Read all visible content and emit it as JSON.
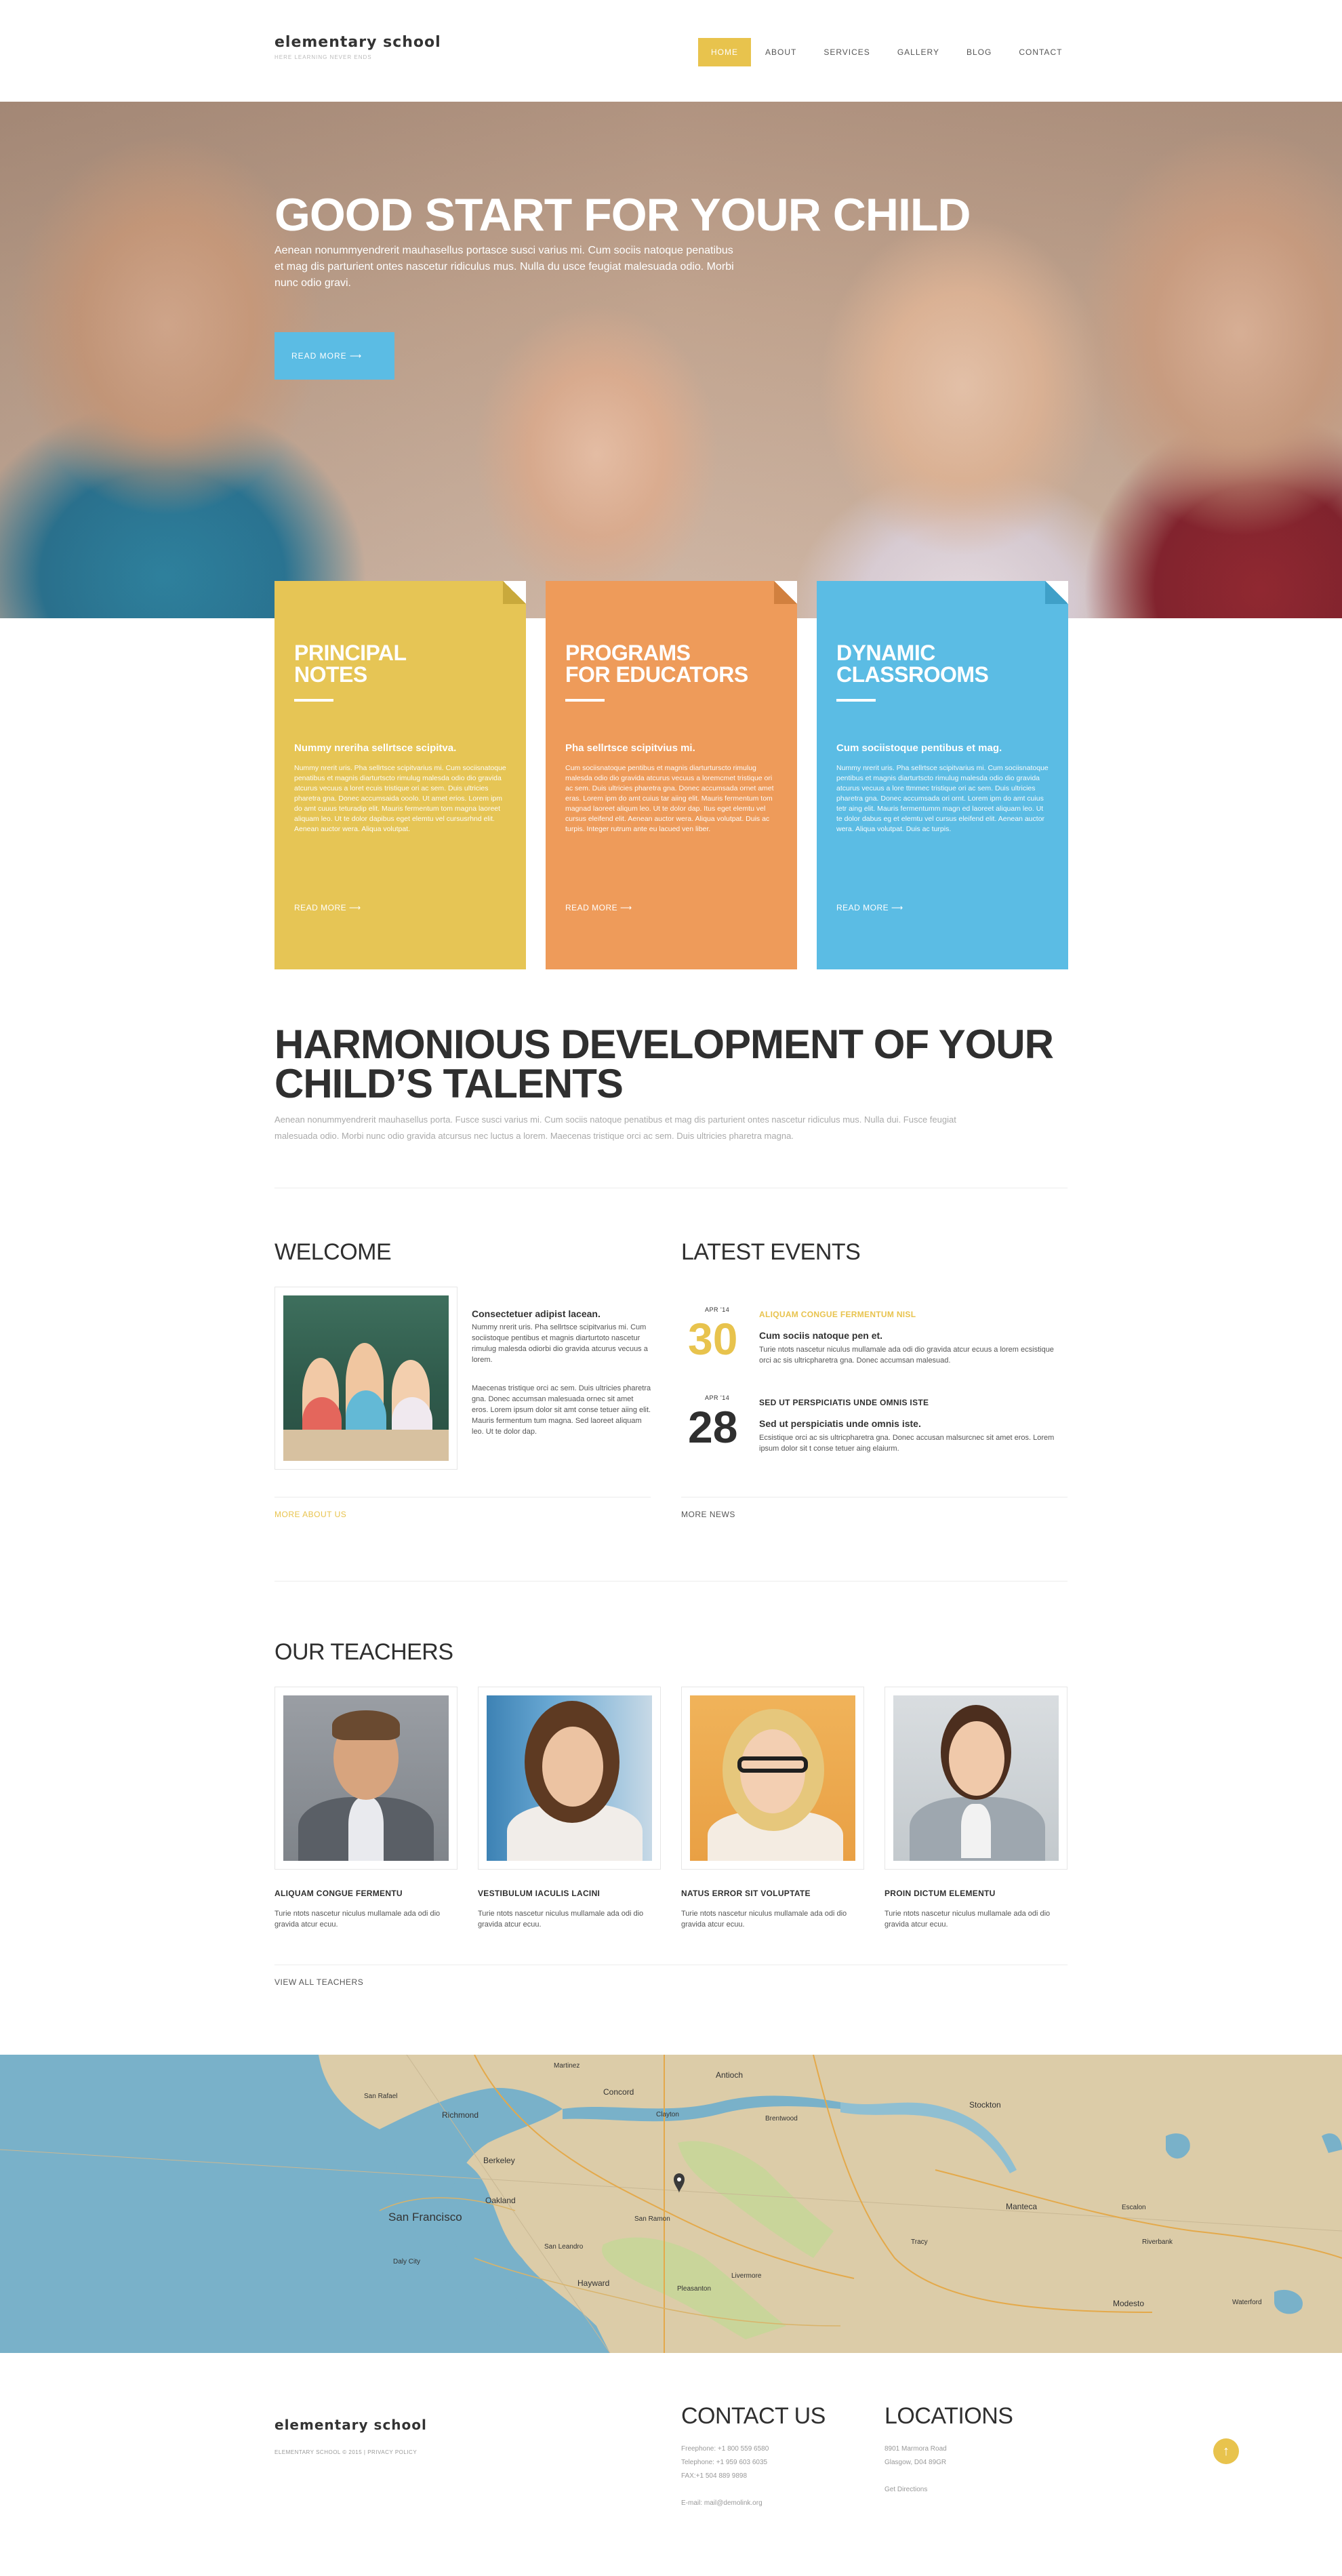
{
  "header": {
    "logo": "elementary school",
    "tagline": "HERE LEARNING NEVER ENDS",
    "nav": [
      "HOME",
      "ABOUT",
      "SERVICES",
      "GALLERY",
      "BLOG",
      "CONTACT"
    ]
  },
  "hero": {
    "title": "GOOD START FOR YOUR CHILD",
    "text": "Aenean nonummyendrerit mauhasellus portasce susci varius mi. Cum sociis natoque penatibus et mag dis parturient ontes nascetur ridiculus mus. Nulla du usce feugiat malesuada odio. Morbi nunc odio gravi.",
    "button": "READ MORE  ⟶"
  },
  "cards": [
    {
      "title_line1": "PRINCIPAL",
      "title_line2": "NOTES",
      "subtitle": "Nummy nreriha sellrtsce scipitva.",
      "body": "Nummy nrerit uris. Pha sellrtsce scipitvarius mi. Cum sociisnatoque penatibus et magnis diarturtscto rimulug malesda odio dio gravida atcurus vecuus a loret ecuis tristique ori ac sem. Duis ultricies pharetra gna. Donec accumsaida ooolo. Ut amet erios. Lorem ipm do amt cuuus teturadip elit. Mauris fermentum tom magna laoreet aliquam leo. Ut te dolor dapibus eget elemtu vel cursusrhnd elit. Aenean auctor wera. Aliqua volutpat.",
      "more": "READ MORE  ⟶"
    },
    {
      "title_line1": "PROGRAMS",
      "title_line2": "FOR EDUCATORS",
      "subtitle": "Pha sellrtsce scipitvius mi.",
      "body": "Cum sociisnatoque pentibus et magnis diarturturscto rimulug malesda odio dio gravida atcurus vecuus a loremcmet tristique ori ac sem. Duis ultricies pharetra gna. Donec accumsada ornet amet eras. Lorem ipm do amt cuius tar aiing elit. Mauris fermentum tom magnad laoreet aliqum leo. Ut te dolor dap. Itus eget elemtu vel cursus eleifend elit. Aenean auctor wera. Aliqua volutpat. Duis ac turpis. Integer rutrum ante eu lacued ven liber.",
      "more": "READ MORE  ⟶"
    },
    {
      "title_line1": "DYNAMIC",
      "title_line2": "CLASSROOMS",
      "subtitle": "Cum sociistoque pentibus et mag.",
      "body": "Nummy nrerit uris. Pha sellrtsce scipitvarius mi. Cum sociisnatoque pentibus et magnis diarturtscto rimulug malesda odio dio gravida atcurus vecuus a lore ttmmec tristique ori ac sem. Duis ultricies pharetra gna. Donec accumsada ori ornt. Lorem ipm do amt cuius tetr aing elit. Mauris fermentumm magn ed laoreet aliquam leo. Ut te dolor dabus eg et elemtu vel cursus eleifend elit. Aenean auctor wera. Aliqua volutpat. Duis ac turpis.",
      "more": "READ MORE  ⟶"
    }
  ],
  "harmonious": {
    "title": "HARMONIOUS DEVELOPMENT OF YOUR CHILD’S TALENTS",
    "text": "Aenean nonummyendrerit mauhasellus porta. Fusce susci varius mi. Cum sociis natoque penatibus et mag dis parturient ontes nascetur ridiculus mus. Nulla dui. Fusce feugiat malesuada odio. Morbi nunc odio gravida atcursus nec luctus a lorem. Maecenas tristique orci ac sem. Duis ultricies pharetra magna."
  },
  "welcome": {
    "heading": "WELCOME",
    "strong": "Consectetuer adipist lacean.",
    "body1": "Nummy nrerit uris. Pha sellrtsce scipitvarius mi. Cum sociistoque pentibus et magnis diarturtoto nascetur rimulug malesda odiorbi dio gravida atcurus vecuus a lorem.",
    "body2": "Maecenas tristique orci ac sem. Duis ultricies pharetra gna. Donec accumsan malesuada ornec sit amet eros. Lorem ipsum dolor sit amt conse tetuer aiing elit. Mauris fermentum tum magna. Sed laoreet aliquam leo. Ut te dolor dap.",
    "more": "MORE ABOUT US"
  },
  "events": {
    "heading": "LATEST EVENTS",
    "items": [
      {
        "month": "APR '14",
        "day": "30",
        "title": "ALIQUAM CONGUE FERMENTUM NISL",
        "subtitle": "Cum sociis natoque pen et.",
        "body": "Turie ntots nascetur niculus mullamale ada odi dio gravida atcur ecuus a lorem ecsistique orci ac sis ultricpharetra gna. Donec accumsan malesuad."
      },
      {
        "month": "APR '14",
        "day": "28",
        "title": "SED UT PERSPICIATIS UNDE OMNIS ISTE",
        "subtitle": "Sed ut perspiciatis unde omnis iste.",
        "body": "Ecsistique orci ac sis ultricpharetra gna. Donec accusan malsurcnec sit amet eros. Lorem ipsum dolor sit t conse tetuer aing elaiurm."
      }
    ],
    "more": "MORE NEWS"
  },
  "teachers": {
    "heading": "OUR TEACHERS",
    "items": [
      {
        "name": "ALIQUAM CONGUE FERMENTU",
        "text": "Turie ntots nascetur niculus mullamale ada odi dio gravida atcur ecuu."
      },
      {
        "name": "VESTIBULUM IACULIS LACINI",
        "text": "Turie ntots nascetur niculus mullamale ada odi dio gravida atcur ecuu."
      },
      {
        "name": "NATUS ERROR SIT VOLUPTATE",
        "text": "Turie ntots nascetur niculus mullamale ada odi dio gravida atcur ecuu."
      },
      {
        "name": "PROIN DICTUM ELEMENTU",
        "text": "Turie ntots nascetur niculus mullamale ada odi dio gravida atcur ecuu."
      }
    ],
    "more": "VIEW ALL TEACHERS"
  },
  "map": {
    "labels": [
      "San Rafael",
      "Richmond",
      "Martinez",
      "Concord",
      "Antioch",
      "Clayton",
      "Brentwood",
      "Stockton",
      "Berkeley",
      "Oakland",
      "San Francisco",
      "San Ramon",
      "Daly City",
      "San Leandro",
      "Hayward",
      "Pleasanton",
      "Livermore",
      "Tracy",
      "Manteca",
      "Escalon",
      "Riverbank",
      "Modesto",
      "Waterford"
    ]
  },
  "footer": {
    "logo": "elementary school",
    "copyright": "ELEMENTARY SCHOOL © 2015 | PRIVACY POLICY",
    "contact_heading": "CONTACT US",
    "contact_lines": [
      "Freephone:   +1 800 559 6580",
      "Telephone:   +1 959 603 6035",
      "FAX:+1 504 889 9898",
      "",
      "E-mail: mail@demolink.org"
    ],
    "locations_heading": "LOCATIONS",
    "location_lines": [
      "8901 Marmora Road",
      "Glasgow, D04 89GR",
      "",
      "Get Directions"
    ],
    "up_icon": "arrow-up-circle-icon"
  },
  "colors": {
    "accent_yellow": "#e8c34d",
    "card_yellow": "#e6c555",
    "card_orange": "#ee9b5a",
    "card_blue": "#5bbce4",
    "event_day_highlight": "#e8c34d",
    "heading_dark": "#2f2f2f"
  }
}
